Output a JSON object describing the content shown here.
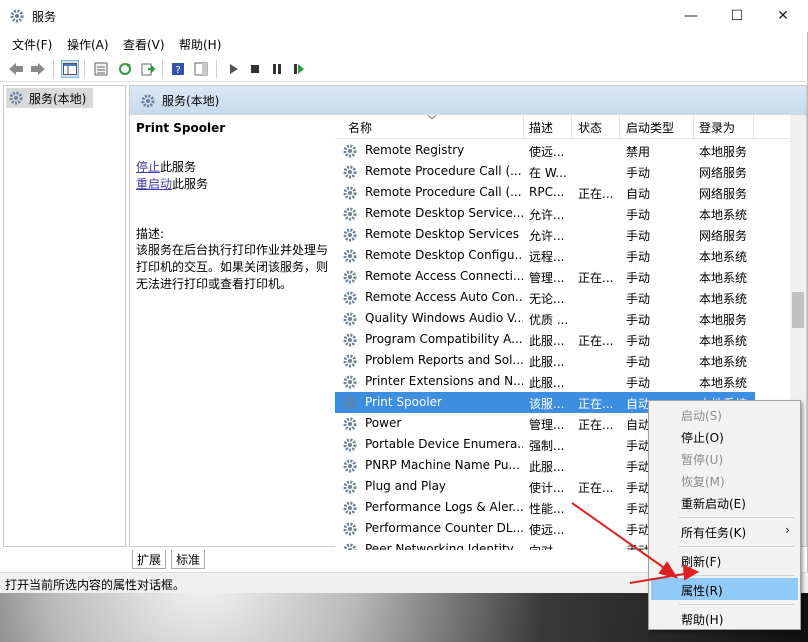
{
  "window": {
    "title": "服务",
    "min": "—",
    "max": "☐",
    "close": "✕"
  },
  "menu": [
    "文件(F)",
    "操作(A)",
    "查看(V)",
    "帮助(H)"
  ],
  "tree": {
    "root": "服务(本地)"
  },
  "main": {
    "header": "服务(本地)"
  },
  "desc": {
    "service": "Print Spooler",
    "stop": "停止",
    "stop_suffix": "此服务",
    "restart": "重启动",
    "restart_suffix": "此服务",
    "label": "描述:",
    "text": "该服务在后台执行打印作业并处理与打印机的交互。如果关闭该服务，则无法进行打印或查看打印机。"
  },
  "columns": [
    "名称",
    "描述",
    "状态",
    "启动类型",
    "登录为"
  ],
  "rows": [
    {
      "name": "Remote Registry",
      "desc": "使远...",
      "status": "",
      "startup": "禁用",
      "logon": "本地服务"
    },
    {
      "name": "Remote Procedure Call (...",
      "desc": "在 W...",
      "status": "",
      "startup": "手动",
      "logon": "网络服务"
    },
    {
      "name": "Remote Procedure Call (...",
      "desc": "RPC...",
      "status": "正在...",
      "startup": "自动",
      "logon": "网络服务"
    },
    {
      "name": "Remote Desktop Service...",
      "desc": "允许...",
      "status": "",
      "startup": "手动",
      "logon": "本地系统"
    },
    {
      "name": "Remote Desktop Services",
      "desc": "允许...",
      "status": "",
      "startup": "手动",
      "logon": "网络服务"
    },
    {
      "name": "Remote Desktop Configu...",
      "desc": "远程...",
      "status": "",
      "startup": "手动",
      "logon": "本地系统"
    },
    {
      "name": "Remote Access Connecti...",
      "desc": "管理...",
      "status": "正在...",
      "startup": "手动",
      "logon": "本地系统"
    },
    {
      "name": "Remote Access Auto Con...",
      "desc": "无论...",
      "status": "",
      "startup": "手动",
      "logon": "本地系统"
    },
    {
      "name": "Quality Windows Audio V...",
      "desc": "优质 ...",
      "status": "",
      "startup": "手动",
      "logon": "本地服务"
    },
    {
      "name": "Program Compatibility A...",
      "desc": "此服...",
      "status": "正在...",
      "startup": "手动",
      "logon": "本地系统"
    },
    {
      "name": "Problem Reports and Sol...",
      "desc": "此服...",
      "status": "",
      "startup": "手动",
      "logon": "本地系统"
    },
    {
      "name": "Printer Extensions and N...",
      "desc": "此服...",
      "status": "",
      "startup": "手动",
      "logon": "本地系统"
    },
    {
      "name": "Print Spooler",
      "desc": "该服...",
      "status": "正在...",
      "startup": "自动",
      "logon": "本地系统"
    },
    {
      "name": "Power",
      "desc": "管理...",
      "status": "正在...",
      "startup": "自动",
      "logon": ""
    },
    {
      "name": "Portable Device Enumera...",
      "desc": "强制...",
      "status": "",
      "startup": "手动",
      "logon": ""
    },
    {
      "name": "PNRP Machine Name Pu...",
      "desc": "此服...",
      "status": "",
      "startup": "手动",
      "logon": ""
    },
    {
      "name": "Plug and Play",
      "desc": "使计...",
      "status": "正在...",
      "startup": "手动",
      "logon": ""
    },
    {
      "name": "Performance Logs & Aler...",
      "desc": "性能...",
      "status": "",
      "startup": "手动",
      "logon": ""
    },
    {
      "name": "Performance Counter DL...",
      "desc": "使远...",
      "status": "",
      "startup": "手动",
      "logon": ""
    },
    {
      "name": "Peer Networking Identity...",
      "desc": "向对...",
      "status": "",
      "startup": "手动",
      "logon": ""
    }
  ],
  "tabs": [
    "扩展",
    "标准"
  ],
  "status": "打开当前所选内容的属性对话框。",
  "context": [
    {
      "label": "启动(S)",
      "disabled": true
    },
    {
      "label": "停止(O)",
      "disabled": false
    },
    {
      "label": "暂停(U)",
      "disabled": true
    },
    {
      "label": "恢复(M)",
      "disabled": true
    },
    {
      "label": "重新启动(E)",
      "disabled": false
    },
    {
      "label": "所有任务(K)",
      "disabled": false,
      "arrow": "›"
    },
    {
      "label": "刷新(F)",
      "disabled": false
    },
    {
      "label": "属性(R)",
      "disabled": false
    },
    {
      "label": "帮助(H)",
      "disabled": false
    }
  ],
  "colors": {
    "selection": "#3d8ee0",
    "menu_hover": "#91c9f7",
    "arrow": "#e02020",
    "header": "#c7d9ec"
  }
}
